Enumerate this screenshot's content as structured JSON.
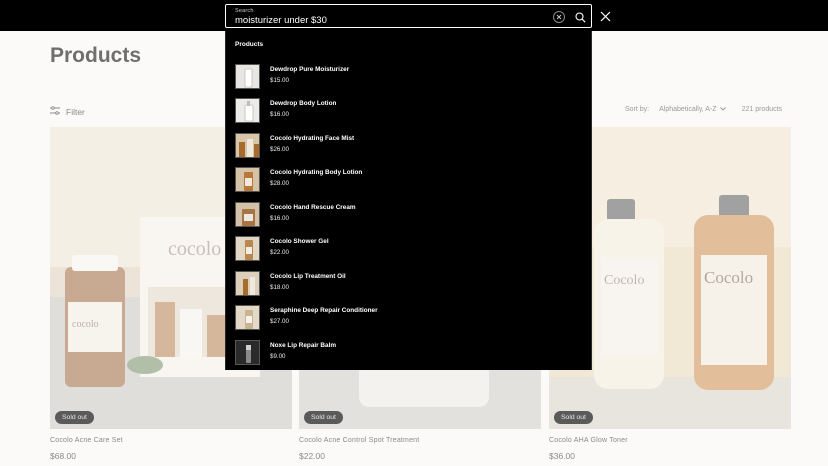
{
  "search": {
    "label": "Search",
    "query": "moisturizer under $30"
  },
  "page": {
    "title": "Products",
    "filter_label": "Filter",
    "sort_label": "Sort by:",
    "sort_value": "Alphabetically, A-Z",
    "product_count": "221 products"
  },
  "products": [
    {
      "name": "Cocolo Acne Care Set",
      "price": "$68.00",
      "badge": "Sold out"
    },
    {
      "name": "Cocolo Acne Control Spot Treatment",
      "price": "$22.00",
      "badge": "Sold out"
    },
    {
      "name": "Cocolo AHA Glow Toner",
      "price": "$36.00",
      "badge": "Sold out"
    }
  ],
  "dropdown": {
    "heading": "Products",
    "results": [
      {
        "name": "Dewdrop Pure Moisturizer",
        "price": "$15.00"
      },
      {
        "name": "Dewdrop Body Lotion",
        "price": "$16.00"
      },
      {
        "name": "Cocolo Hydrating Face Mist",
        "price": "$26.00"
      },
      {
        "name": "Cocolo Hydrating Body Lotion",
        "price": "$28.00"
      },
      {
        "name": "Cocolo Hand Rescue Cream",
        "price": "$16.00"
      },
      {
        "name": "Cocolo Shower Gel",
        "price": "$22.00"
      },
      {
        "name": "Cocolo Lip Treatment Oil",
        "price": "$18.00"
      },
      {
        "name": "Seraphine Deep Repair Conditioner",
        "price": "$27.00"
      },
      {
        "name": "Noxe Lip Repair Balm",
        "price": "$9.00"
      }
    ]
  },
  "icons": {
    "clear": "clear-icon",
    "search": "search-icon",
    "close": "close-icon",
    "filter": "filter-icon",
    "sort": "chevron-down-icon"
  },
  "colors": {
    "header_bg": "#000000",
    "page_bg": "#fbfaf8",
    "badge_bg": "#5a5a5a"
  }
}
